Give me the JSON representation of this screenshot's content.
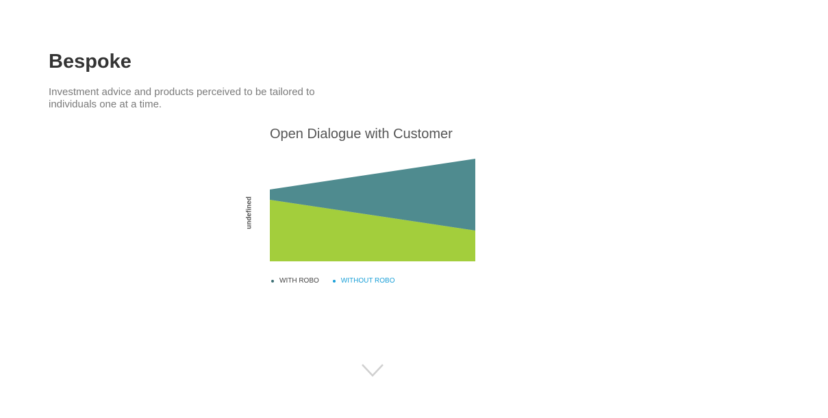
{
  "header": {
    "title": "Bespoke",
    "subtitle": "Investment advice and products perceived to be tailored to individuals one at a time."
  },
  "chart_data": {
    "type": "area",
    "title": "Open Dialogue with Customer",
    "xlabel": "",
    "ylabel": "undefined",
    "x": [
      0,
      1
    ],
    "series": [
      {
        "name": "WITH ROBO",
        "values": [
          90,
          45
        ],
        "color": "#a3ce3c"
      },
      {
        "name": "WITHOUT ROBO",
        "values": [
          15,
          105
        ],
        "color": "#4f8b8f"
      }
    ],
    "stacked": true,
    "ylim": [
      0,
      150
    ],
    "grid": false,
    "legend_position": "bottom-left",
    "legend_colors": [
      "#3d6f74",
      "#1aa0d8"
    ]
  },
  "icons": {
    "scroll": "chevron-down-icon"
  }
}
